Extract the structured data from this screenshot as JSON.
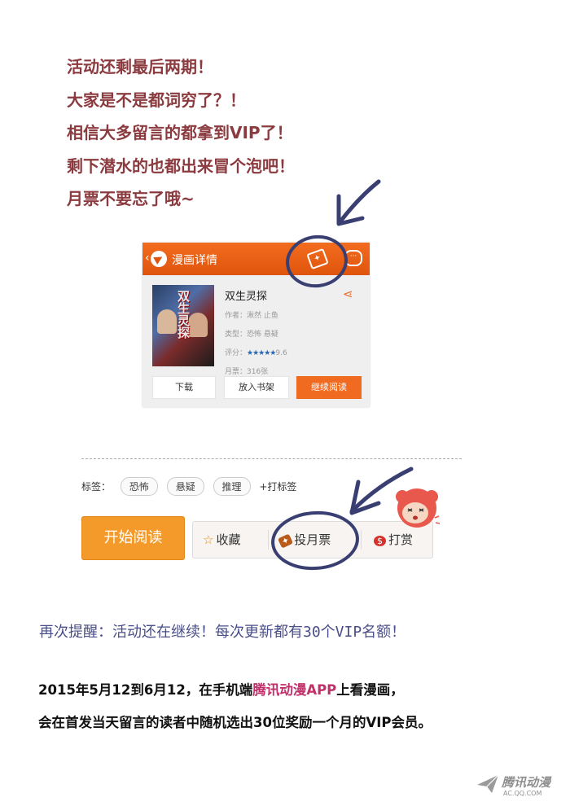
{
  "intro_lines": [
    "活动还剩最后两期！",
    "大家是不是都词穷了？！",
    "相信大多留言的都拿到VIP了！",
    "剩下潜水的也都出来冒个泡吧！",
    "月票不要忘了哦~"
  ],
  "card": {
    "header_title": "漫画详情",
    "back_icon": "‹",
    "ticket_icon": "✦",
    "chat_icon": "···",
    "cover_text": "双生灵探",
    "name": "双生灵探",
    "author_label": "作者：",
    "author": "湫然 止鱼",
    "type_label": "类型：",
    "type": "恐怖 悬疑",
    "rating_label": "评分：",
    "stars": "★★★★★",
    "rating": "9.6",
    "ticket_label": "月票：",
    "tickets": "316张",
    "share_icon": "⋖",
    "btn_download": "下载",
    "btn_shelf": "放入书架",
    "btn_read": "继续阅读"
  },
  "tags": {
    "label": "标签：",
    "items": [
      "恐怖",
      "悬疑",
      "推理"
    ],
    "add": "+打标签"
  },
  "actions": {
    "start": "开始阅读",
    "fav": "收藏",
    "fav_icon": "☆",
    "vote": "投月票",
    "vote_icon": "✦",
    "tip": "打赏",
    "tip_icon": "$"
  },
  "reminder": "再次提醒：活动还在继续！每次更新都有30个VIP名额！",
  "body": {
    "line1_a": "2015年5月12到6月12，在手机端",
    "line1_hl": "腾讯动漫APP",
    "line1_b": "上看漫画，",
    "line2": "会在首发当天留言的读者中随机选出30位奖励一个月的VIP会员。"
  },
  "watermark": {
    "text": "腾讯动漫",
    "url": "AC.QQ.COM"
  },
  "colors": {
    "intro": "#8b3b3f",
    "accent_orange": "#f06a20",
    "reminder": "#4a4f8a",
    "highlight": "#c1306a",
    "ink": "#3a3f72"
  }
}
